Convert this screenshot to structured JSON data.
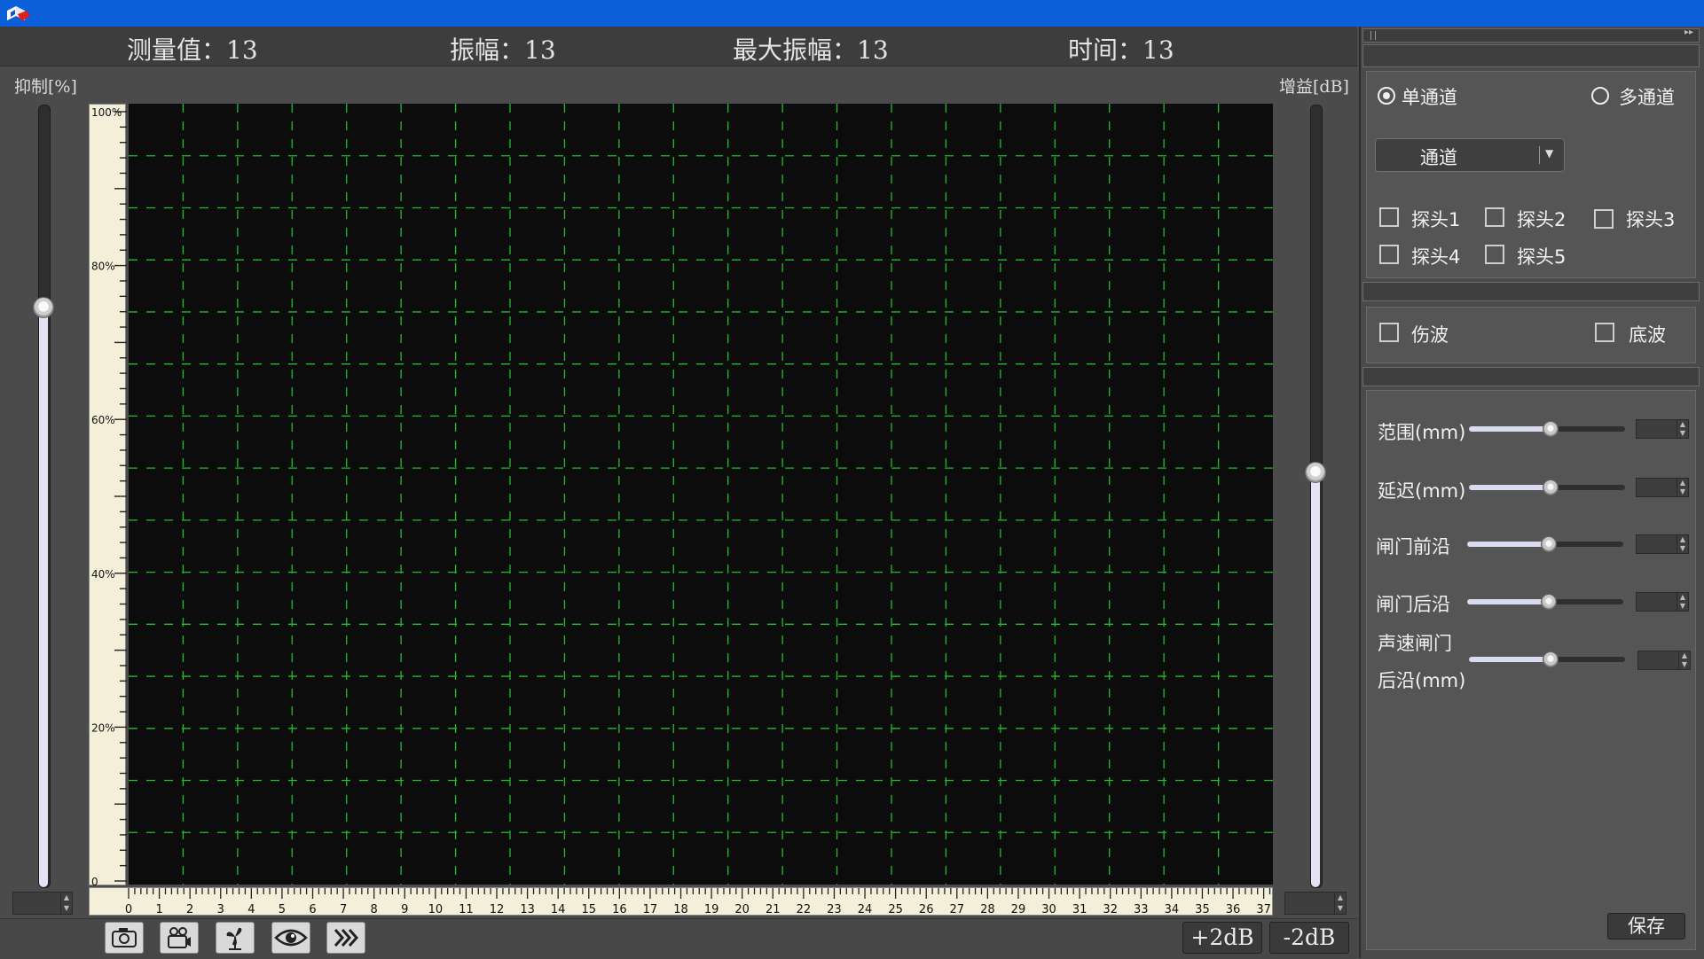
{
  "window": {
    "title": ""
  },
  "readouts": {
    "measure": "测量值：13",
    "amplitude": "振幅：13",
    "max_amplitude": "最大振幅：13",
    "time": "时间：13"
  },
  "left_slider": {
    "label": "抑制[%]",
    "value_fraction": 0.74
  },
  "right_slider": {
    "label": "增益[dB]",
    "value_fraction": 0.53
  },
  "v_ruler": {
    "labels": [
      "100%",
      "80%",
      "60%",
      "40%",
      "20%",
      "0"
    ]
  },
  "h_ruler": {
    "labels": [
      "0",
      "1",
      "2",
      "3",
      "4",
      "5",
      "6",
      "7",
      "8",
      "9",
      "10",
      "11",
      "12",
      "13",
      "14",
      "15",
      "16",
      "17",
      "18",
      "19",
      "20",
      "21",
      "22",
      "23",
      "24",
      "25",
      "26",
      "27",
      "28",
      "29",
      "30",
      "31",
      "32",
      "33",
      "34",
      "35",
      "36",
      "37"
    ]
  },
  "scope": {
    "background": "#0c0c0c",
    "grid_color": "#1fbf2a",
    "columns": 21,
    "rows": 15
  },
  "toolbar": {
    "icons": [
      "camera-icon",
      "video-camera-icon",
      "fan-icon",
      "eye-icon",
      "fast-forward-icon"
    ],
    "plus_db": "+2dB",
    "minus_db": "-2dB"
  },
  "panel": {
    "single_channel": "单通道",
    "multi_channel": "多通道",
    "channel_select": "通道",
    "probes": [
      "探头1",
      "探头2",
      "探头3",
      "探头4",
      "探头5"
    ],
    "flaw_wave": "伤波",
    "bottom_wave": "底波",
    "sliders": [
      {
        "label": "范围(mm)",
        "value_fraction": 0.53
      },
      {
        "label": "延迟(mm)",
        "value_fraction": 0.53
      },
      {
        "label": "闸门前沿",
        "value_fraction": 0.53
      },
      {
        "label": "闸门后沿",
        "value_fraction": 0.53
      },
      {
        "label_line1": "声速闸门",
        "label_line2": "后沿(mm)",
        "value_fraction": 0.53
      }
    ],
    "save": "保存"
  }
}
